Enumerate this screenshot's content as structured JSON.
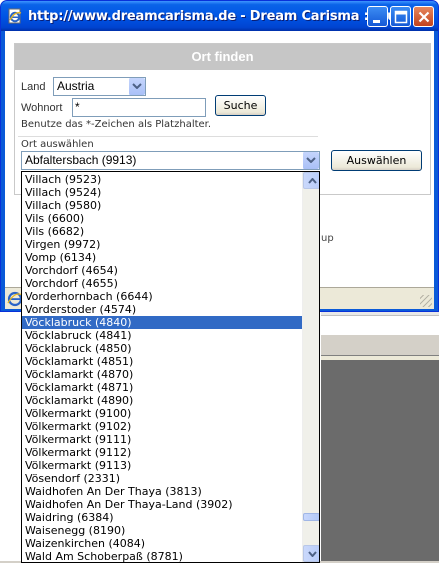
{
  "window": {
    "title": "http://www.dreamcarisma.de - Dream Carisma :: Su..."
  },
  "panel": {
    "heading": "Ort finden",
    "land_label": "Land",
    "land_value": "Austria",
    "wohnort_label": "Wohnort",
    "wohnort_value": "*",
    "search_button": "Suche",
    "hint": "Benutze das *-Zeichen als Platzhalter.",
    "ort_label": "Ort auswählen",
    "ort_selected": "Abfaltersbach (9913)",
    "choose_button": "Auswählen",
    "background_fragment": "up"
  },
  "list": {
    "items": [
      "Villach (9523)",
      "Villach (9524)",
      "Villach (9580)",
      "Vils (6600)",
      "Vils (6682)",
      "Virgen (9972)",
      "Vomp (6134)",
      "Vorchdorf (4654)",
      "Vorchdorf (4655)",
      "Vorderhornbach (6644)",
      "Vorderstoder (4574)",
      "Vöcklabruck (4840)",
      "Vöcklabruck (4841)",
      "Vöcklabruck (4850)",
      "Vöcklamarkt (4851)",
      "Vöcklamarkt (4870)",
      "Vöcklamarkt (4871)",
      "Vöcklamarkt (4890)",
      "Völkermarkt (9100)",
      "Völkermarkt (9102)",
      "Völkermarkt (9111)",
      "Völkermarkt (9112)",
      "Völkermarkt (9113)",
      "Vösendorf (2331)",
      "Waidhofen An Der Thaya (3813)",
      "Waidhofen An Der Thaya-Land (3902)",
      "Waidring (6384)",
      "Waisenegg (8190)",
      "Waizenkirchen (4084)",
      "Wald Am Schoberpaß (8781)"
    ],
    "selected_index": 11,
    "scroll_position": 0.93
  },
  "colors": {
    "titlebar": "#0055e5",
    "selection": "#316ac5",
    "panel_header": "#c6c6c6"
  },
  "icons": {
    "app": "ie-page-icon",
    "status": "ie-status-icon"
  }
}
